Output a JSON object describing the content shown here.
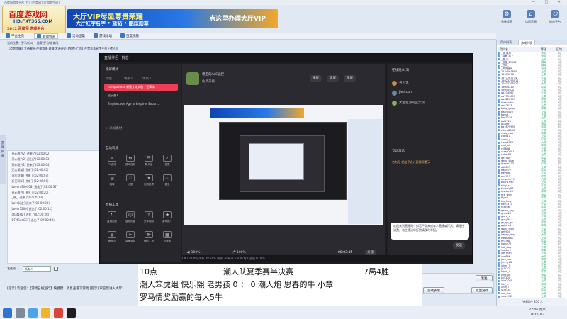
{
  "window": {
    "title": "百度网游戏平台 大厅 [百度网大厅游戏空间]",
    "controls": "— □ ✕"
  },
  "logo": {
    "line1": "百度游戏网",
    "line2": "HD.FXT365.COM",
    "line3": "2012 百度网 游戏平台"
  },
  "banner": {
    "line1": "大厅VIP尽显尊贵荣耀",
    "line2": "大厅红字名字 • 篮钻 • 酷炫勋章",
    "line3": "点这里办理大厅VIP"
  },
  "top_tools": [
    {
      "label": "系统设置",
      "icon": "⚙"
    },
    {
      "label": "访问官网",
      "icon": "⌂"
    },
    {
      "label": "退出平台",
      "icon": "⏻"
    }
  ],
  "nav": [
    {
      "label": "平台主页",
      "active": false
    },
    {
      "label": "新闻频道",
      "active": true
    },
    {
      "label": "活动征集",
      "active": false
    },
    {
      "label": "游戏论坛",
      "active": false
    },
    {
      "label": "百度视频",
      "active": false
    }
  ],
  "address": "当前位置：罗马新纠 → 比赛 罗马城 休闲",
  "notice": "【点赞提醒】大帝聚光·严格管理·自律·发表评论【免费·广告】严禁非法宣传平台上传人员",
  "left_tab": "游戏列表",
  "chat_log": [
    "[开心雅兴2] 进来了(02:00:02)",
    "[开心雅兴2] 退出了(02:00:03)",
    "[开心雅兴1] 进来了(02:00:04)",
    "[无名英雄] 进来了(02:00:05)",
    "[冠军联盟] 进来了(02:00:07)",
    "[新亚网Ni] 进来了(02:00:08)",
    "[Lover4900308] 退出了(02:00:37)",
    "[开心雅兴] 退出了(02:00:20)",
    "[_映_] 进来了(02:00:23)",
    "[Love好友] 进来了(02:00:30)",
    "[Lover3200] 退出了(02:00:11)",
    "[chat好友] 进来了(02:00:28)",
    "[DFMSdaGEF] 退出了(02:00:40)"
  ],
  "input_row": {
    "label": "发送给",
    "target": "所有人"
  },
  "bottom_status": "[提示] 欢迎您：【游戏已经运行】快捷键：消息查看下游戏  [提示] 欢迎您进入大厅！",
  "send_buttons": {
    "send": "发送",
    "settings": "聊天设置",
    "emoji": "游戏表情",
    "exit": "退出游戏"
  },
  "right_panel": {
    "tabs": [
      "用户列表",
      "游戏列表"
    ],
    "headers": [
      "用户名",
      "等级",
      "区域"
    ],
    "users": [
      {
        "name": "_映_姜风",
        "rank": "大将",
        "div": "1区"
      },
      {
        "name": "_溺爱_心上",
        "rank": "大将",
        "div": "1区"
      },
      {
        "name": "_情_东",
        "rank": "上将",
        "div": "1区"
      },
      {
        "name": "_浪漫_29902",
        "rank": "将军",
        "div": "2区"
      },
      {
        "name": "_苍天_",
        "rank": "将军",
        "div": "1区"
      },
      {
        "name": "_风华绝代",
        "rank": "元帅",
        "div": "1区"
      },
      {
        "name": "1234567890",
        "rank": "上将",
        "div": "2区"
      },
      {
        "name": "12345678",
        "rank": "上尉",
        "div": "1区"
      },
      {
        "name": "1377763734",
        "rank": "少将",
        "div": "1区"
      },
      {
        "name": "15023295011",
        "rank": "上将",
        "div": "3区"
      },
      {
        "name": "15023295022",
        "rank": "大将",
        "div": "1区"
      },
      {
        "name": "18009220",
        "rank": "中将",
        "div": "2区"
      },
      {
        "name": "59944400",
        "rank": "上将",
        "div": "2区"
      },
      {
        "name": "a1234567",
        "rank": "少将",
        "div": "1区"
      },
      {
        "name": "aa7334003",
        "rank": "上尉",
        "div": "1区"
      },
      {
        "name": "ad6226909",
        "rank": "中将",
        "div": "1区"
      },
      {
        "name": "Alexander",
        "rank": "少尉",
        "div": "2区"
      },
      {
        "name": "ann2013",
        "rank": "上尉",
        "div": "1区"
      },
      {
        "name": "baby_gogo",
        "rank": "中尉",
        "div": "1区"
      },
      {
        "name": "bear2020",
        "rank": "上将",
        "div": "2区"
      },
      {
        "name": "boss8",
        "rank": "上将",
        "div": "1区"
      },
      {
        "name": "boy1234",
        "rank": "上尉",
        "div": "1区"
      },
      {
        "name": "bsl8726",
        "rank": "上将",
        "div": "1区"
      },
      {
        "name": "buzzer",
        "rank": "大将",
        "div": "1区"
      },
      {
        "name": "bx1679990",
        "rank": "中将",
        "div": "3区"
      },
      {
        "name": "cdxcy8866",
        "rank": "少将",
        "div": "2区"
      },
      {
        "name": "chao_cool",
        "rank": "中尉",
        "div": "1区"
      },
      {
        "name": "clark11",
        "rank": "上尉",
        "div": "1区"
      },
      {
        "name": "cloud_x",
        "rank": "少将",
        "div": "1区"
      },
      {
        "name": "coco2008",
        "rank": "大将",
        "div": "2区"
      },
      {
        "name": "cool_ok",
        "rank": "中将",
        "div": "1区"
      },
      {
        "name": "cr8888",
        "rank": "上将",
        "div": "1区"
      },
      {
        "name": "crazy0001",
        "rank": "少尉",
        "div": "2区"
      },
      {
        "name": "cyber86",
        "rank": "上尉",
        "div": "1区"
      },
      {
        "name": "dd1980",
        "rank": "中尉",
        "div": "1区"
      },
      {
        "name": "deep_blue",
        "rank": "大将",
        "div": "1区"
      },
      {
        "name": "dream233",
        "rank": "少将",
        "div": "3区"
      },
      {
        "name": "dy8899",
        "rank": "上将",
        "div": "1区"
      },
      {
        "name": "eagle777",
        "rank": "中将",
        "div": "2区"
      },
      {
        "name": "easygo",
        "rank": "上尉",
        "div": "1区"
      },
      {
        "name": "ecc123",
        "rank": "中尉",
        "div": "1区"
      },
      {
        "name": "emperor_9",
        "rank": "元帅",
        "div": "1区"
      },
      {
        "name": "evan1990",
        "rank": "上将",
        "div": "2区"
      },
      {
        "name": "fairy_z",
        "rank": "少将",
        "div": "1区"
      },
      {
        "name": "fantasy88",
        "rank": "上尉",
        "div": "1区"
      },
      {
        "name": "fashion12",
        "rank": "中将",
        "div": "1区"
      },
      {
        "name": "fire_wolf",
        "rank": "大将",
        "div": "2区"
      },
      {
        "name": "flyer2",
        "rank": "中尉",
        "div": "1区"
      },
      {
        "name": "fox_king",
        "rank": "上将",
        "div": "1区"
      },
      {
        "name": "free1314",
        "rank": "少尉",
        "div": "3区"
      },
      {
        "name": "fz5566",
        "rank": "中将",
        "div": "1区"
      },
      {
        "name": "game_boy",
        "rank": "上尉",
        "div": "1区"
      },
      {
        "name": "ghost22",
        "rank": "大将",
        "div": "2区"
      },
      {
        "name": "giant_x",
        "rank": "少将",
        "div": "1区"
      },
      {
        "name": "glory99",
        "rank": "上将",
        "div": "1区"
      },
      {
        "name": "go_go_go",
        "rank": "中尉",
        "div": "1区"
      },
      {
        "name": "golden8",
        "rank": "中将",
        "div": "2区"
      },
      {
        "name": "good_man",
        "rank": "上尉",
        "div": "1区"
      },
      {
        "name": "gz9900",
        "rank": "少尉",
        "div": "1区"
      },
      {
        "name": "happy_day",
        "rank": "大将",
        "div": "1区"
      },
      {
        "name": "hero1688",
        "rank": "上将",
        "div": "2区"
      },
      {
        "name": "hh2468",
        "rank": "中将",
        "div": "1区"
      },
      {
        "name": "home77",
        "rank": "上尉",
        "div": "1区"
      },
      {
        "name": "hot_dog",
        "rank": "少将",
        "div": "1区"
      },
      {
        "name": "hunter5",
        "rank": "中尉",
        "div": "3区"
      },
      {
        "name": "ice_man",
        "rank": "上将",
        "div": "1区"
      },
      {
        "name": "idol666",
        "rank": "大将",
        "div": "1区"
      },
      {
        "name": "jack_ma",
        "rank": "中将",
        "div": "2区"
      },
      {
        "name": "jimmy88",
        "rank": "上尉",
        "div": "1区"
      },
      {
        "name": "joker_7",
        "rank": "少尉",
        "div": "1区"
      },
      {
        "name": "jy1122",
        "rank": "上将",
        "div": "1区"
      },
      {
        "name": "kevin_li",
        "rank": "中尉",
        "div": "2区"
      },
      {
        "name": "king_of",
        "rank": "大将",
        "div": "1区"
      },
      {
        "name": "kk5201",
        "rank": "少将",
        "div": "1区"
      },
      {
        "name": "lake2000",
        "rank": "上将",
        "div": "1区"
      },
      {
        "name": "lion_x",
        "rank": "中将",
        "div": "2区"
      },
      {
        "name": "lucky77",
        "rank": "上尉",
        "div": "1区"
      },
      {
        "name": "lz3344",
        "rank": "中尉",
        "div": "1区"
      },
      {
        "name": "ma_ster",
        "rank": "大将",
        "div": "1区"
      },
      {
        "name": "max1985",
        "rank": "上将",
        "div": "3区"
      }
    ],
    "footer": "在线用户 376 人"
  },
  "obs": {
    "app_title": "直播伴侣 · 抖音",
    "mode": "横屏模式",
    "scene_tabs": [
      "场景1",
      "场景2",
      "场景3"
    ],
    "sources": [
      "notepad.exe 新建文本文档 - 记事本",
      "显示器1",
      "Empires.exe Age of Empires Expan..."
    ],
    "add_source": "+ 添加素材",
    "tools_title": "互动玩法",
    "tools": [
      "PK连线",
      "观众连线",
      "聊天室",
      "投票",
      "福袋",
      "心愿",
      "礼物投票",
      "更多"
    ],
    "live_tools_title": "直播工具",
    "live_tools": [
      "直播回放",
      "虚拟形象",
      "分享视频",
      "游戏推广",
      "管理员",
      "直播剪片",
      "辅助工具",
      "小程序"
    ],
    "room_name": "稳定的AoE远控",
    "room_sub": "免费开播",
    "scene_btns": [
      "横屏",
      "竖屏",
      "多屏"
    ],
    "ctrl_left": "◀) 100%",
    "ctrl_mid": "🎤 100%",
    "timer": "00:03:35",
    "end_btn": "关播",
    "status": "CPU 2.00%   内存 48.81%   帧率 30   码率 2500kbps   丢帧 0.00%",
    "right_title": "在线观众(3)",
    "viewers": [
      "名为无",
      "Jieri.con",
      "大宝巡游的蓝大叔"
    ],
    "gift_title": "互动消息",
    "gift_msg": "名为无 发出了进入直播间提示",
    "chat_notice": "欢迎来到直播间！抖音严禁未成年人直播或打赏，请理性消费，若主播诱导打赏请及时举报。",
    "chat_send": "发送"
  },
  "overlay": {
    "r1c1": "10点",
    "r1c2": "潮人队夏季赛半决赛",
    "r1c3": "7局4胜",
    "r2": "潮人笨虎组  快乐熙  老男孩   0  ：   0   潮人炮  思春的牛  小章",
    "r3": "罗马情奖励赢的每人5牛"
  },
  "clock": {
    "time": "22:06 周六",
    "date": "2022/7/2"
  }
}
